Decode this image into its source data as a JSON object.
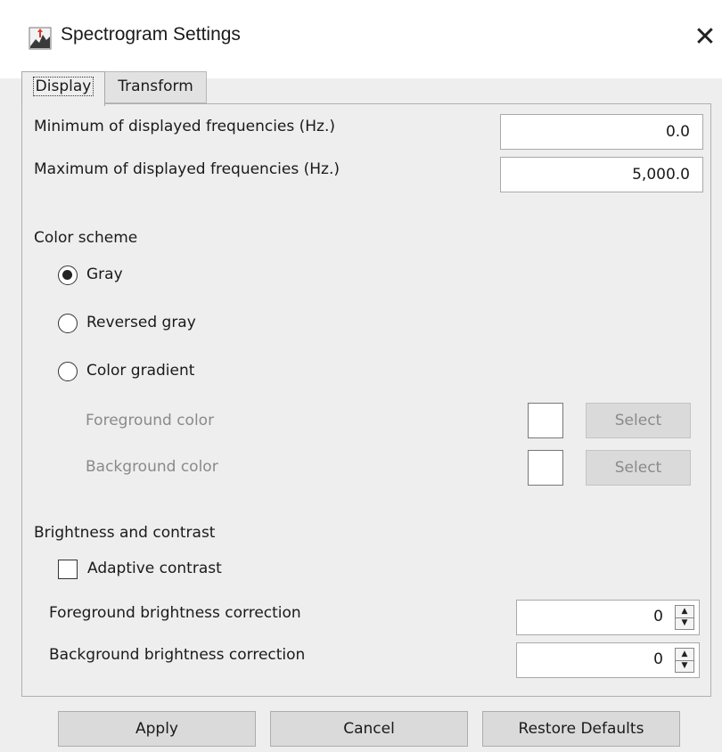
{
  "window": {
    "title": "Spectrogram Settings",
    "app_icon": "spectrogram-app-icon",
    "close_glyph": "✕"
  },
  "tabs": [
    {
      "label": "Display",
      "selected": true
    },
    {
      "label": "Transform",
      "selected": false
    }
  ],
  "frequencies": {
    "min_label": "Minimum of displayed frequencies (Hz.)",
    "min_value": "0.0",
    "max_label": "Maximum of displayed frequencies (Hz.)",
    "max_value": "5,000.0"
  },
  "color_scheme": {
    "heading": "Color scheme",
    "options": [
      {
        "label": "Gray",
        "selected": true
      },
      {
        "label": "Reversed gray",
        "selected": false
      },
      {
        "label": "Color gradient",
        "selected": false
      }
    ],
    "foreground_label": "Foreground color",
    "background_label": "Background color",
    "select_label": "Select",
    "foreground_swatch": "#ffffff",
    "background_swatch": "#ffffff"
  },
  "brightness": {
    "heading": "Brightness and contrast",
    "adaptive_label": "Adaptive contrast",
    "adaptive_checked": false,
    "fg_label": "Foreground brightness correction",
    "fg_value": "0",
    "bg_label": "Background brightness correction",
    "bg_value": "0"
  },
  "buttons": {
    "apply": "Apply",
    "cancel": "Cancel",
    "restore": "Restore Defaults"
  }
}
